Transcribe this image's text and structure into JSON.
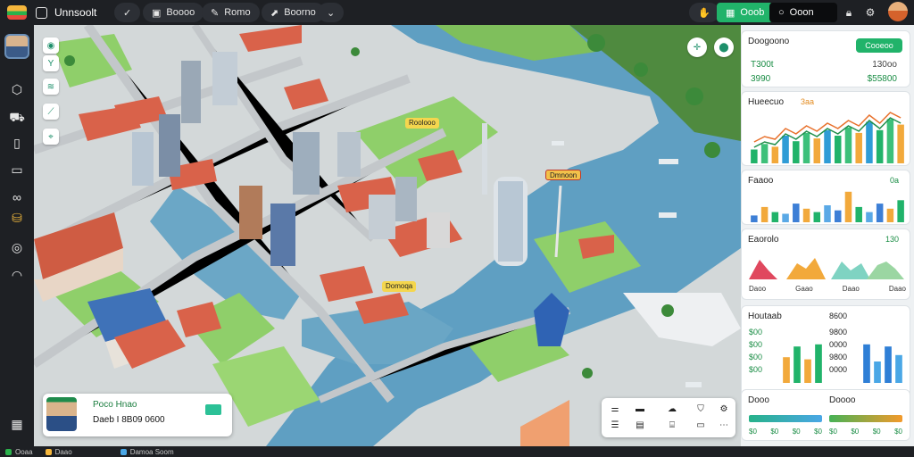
{
  "app": {
    "title": "Unnsoolt"
  },
  "toolbar": {
    "button_1": "Boooo",
    "button_2": "Romo",
    "button_3": "Boorno",
    "accent_button": "Ooob",
    "search_value": "Ooon"
  },
  "map": {
    "labels": [
      "Roolooo",
      "Dmnoon",
      "Domoqa"
    ]
  },
  "profile": {
    "name": "Poco Hnao",
    "line": "Daeb I 8B09 0600"
  },
  "panel": {
    "header_title": "Doogoono",
    "add_label": "Cooeoo",
    "stat_1": "T300t",
    "stat_1_right": "130oo",
    "stat_2": "3990",
    "stat_2_right": "$55800",
    "chart1_title": "Hueecuo",
    "chart1_badge": "3aa",
    "chart1_values": [
      0.25,
      0.35,
      0.3,
      0.5,
      0.4,
      0.55,
      0.45,
      0.6,
      0.5,
      0.65,
      0.55,
      0.75,
      0.6,
      0.8,
      0.7
    ],
    "chart2_title": "Faaoo",
    "chart2_badge": "0a",
    "chart2_values": [
      0.2,
      0.45,
      0.3,
      0.25,
      0.55,
      0.4,
      0.3,
      0.5,
      0.35,
      0.9,
      0.45,
      0.3,
      0.55,
      0.4,
      0.65
    ],
    "chart3_title": "Eaorolo",
    "chart3_badge": "130",
    "chart3_captions": [
      "Daoo",
      "Gaao",
      "Daao",
      "Daao"
    ],
    "stats_title": "Houtaab",
    "stats_value": "8600",
    "stats_rows": [
      "$00",
      "$00",
      "$00",
      "$00"
    ],
    "stats_rows_right": [
      "9800",
      "0000",
      "9800",
      "0000"
    ],
    "chart4_values": [
      0.6,
      0.85,
      0.55,
      0.9
    ],
    "chart5_values": [
      0.9,
      0.5,
      0.85,
      0.65
    ],
    "bottom_title": "Dooo",
    "bottom_right_title": "Doooo",
    "bottom_left_ticks": [
      "$0",
      "$0",
      "$0",
      "$0"
    ],
    "bottom_right_ticks": [
      "$0",
      "$0",
      "$0",
      "$0"
    ]
  },
  "statusbar": {
    "item_1": "Ooaa",
    "item_2": "Daao",
    "item_3": "Damoa Soom"
  },
  "colors": {
    "accent": "#21b36a",
    "water": "#5f9fc2",
    "park": "#8fcf6a",
    "road": "#c9cdd0",
    "roof": "#d9624a"
  }
}
